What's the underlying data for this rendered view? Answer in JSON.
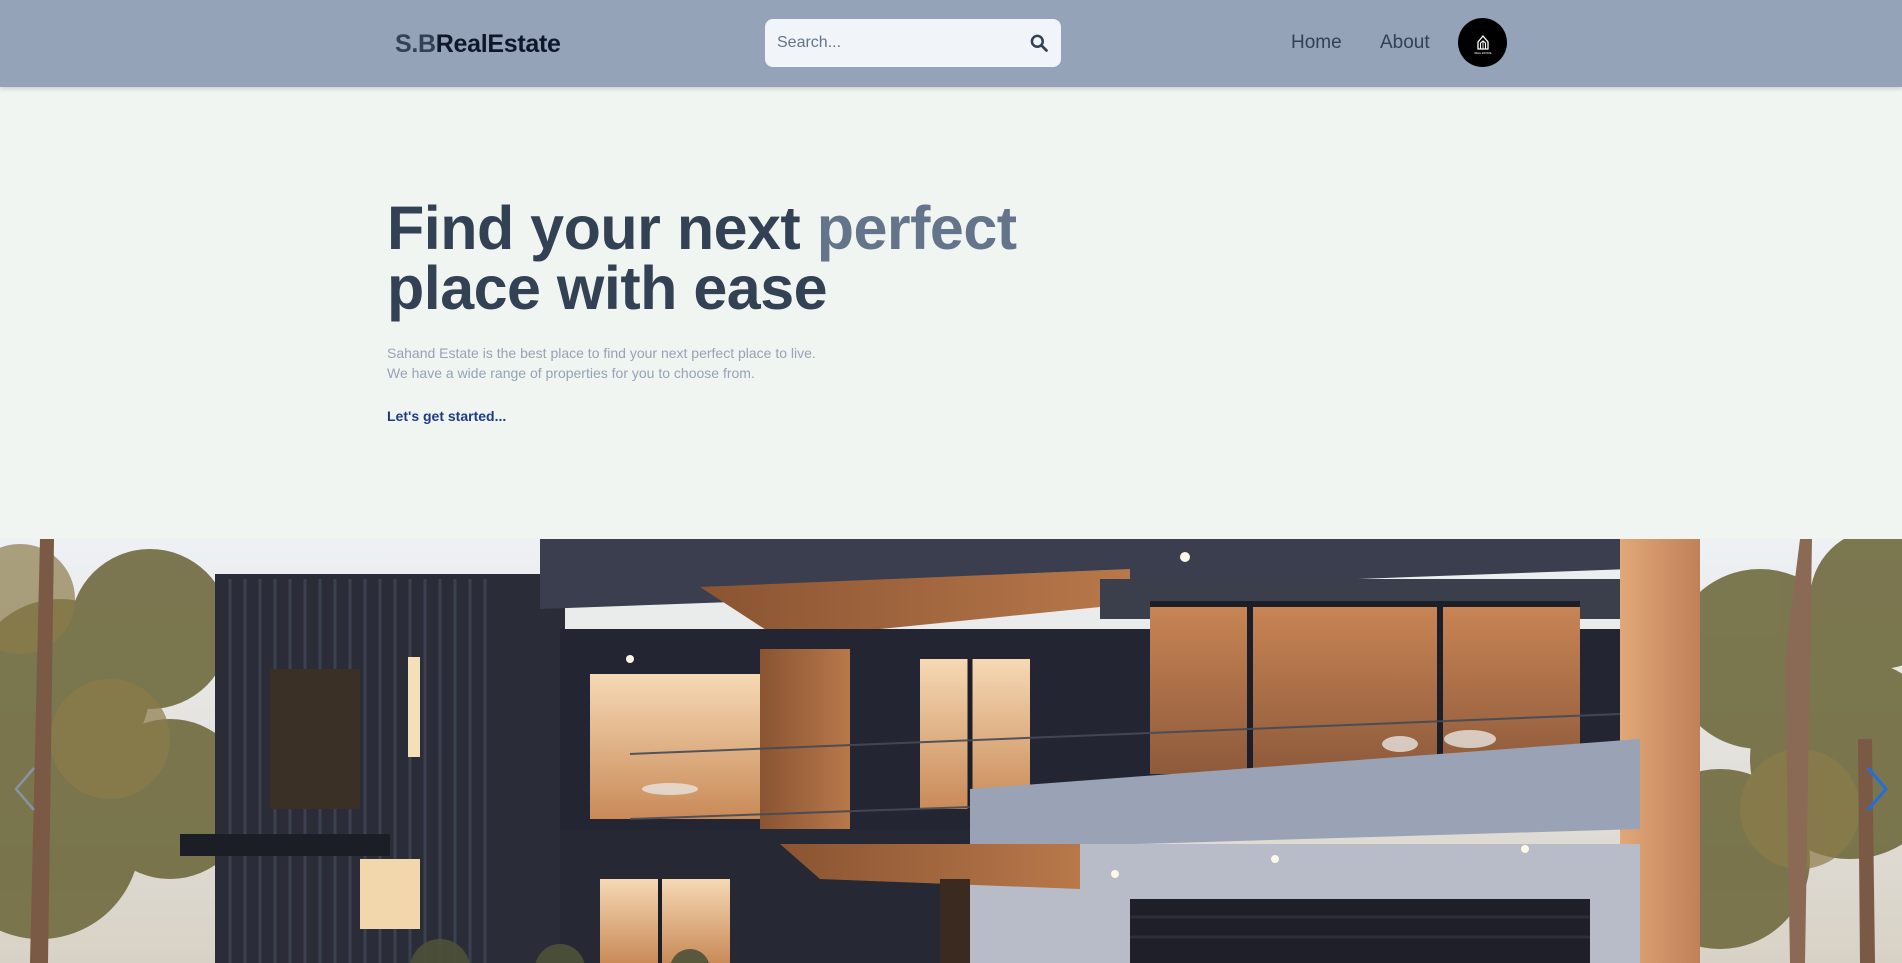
{
  "header": {
    "logo_part1": "S.B",
    "logo_part2": "RealEstate",
    "search_placeholder": "Search...",
    "nav": {
      "home": "Home",
      "about": "About"
    },
    "avatar_text": "REAL ESTATE"
  },
  "hero": {
    "title_part1": "Find your next ",
    "title_accent": "perfect",
    "title_part2": "place with ease",
    "description_line1": "Sahand Estate is the best place to find your next perfect place to live.",
    "description_line2": "We have a wide range of properties for you to choose from.",
    "cta": "Let's get started..."
  },
  "slider": {
    "prev_icon": "chevron-left-icon",
    "next_icon": "chevron-right-icon"
  },
  "colors": {
    "header_bg": "#94a3b8",
    "page_bg": "#f1f5f1",
    "title": "#334155",
    "accent": "#64748b",
    "cta": "#1e3a8a"
  }
}
